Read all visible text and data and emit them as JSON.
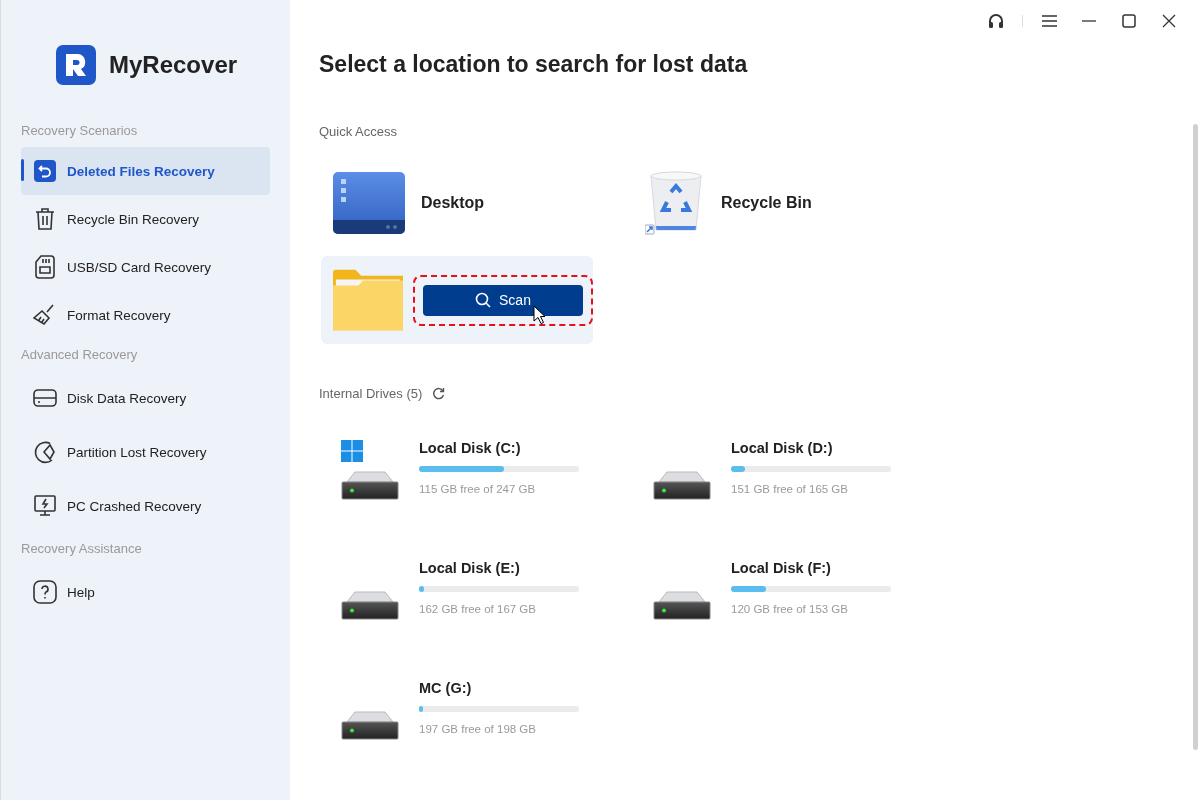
{
  "app": {
    "name": "MyRecover"
  },
  "sidebar": {
    "sections": [
      {
        "heading": "Recovery Scenarios",
        "items": [
          {
            "label": "Deleted Files Recovery",
            "selected": true
          },
          {
            "label": "Recycle Bin Recovery",
            "selected": false
          },
          {
            "label": "USB/SD Card Recovery",
            "selected": false
          },
          {
            "label": "Format Recovery",
            "selected": false
          }
        ]
      },
      {
        "heading": "Advanced Recovery",
        "items": [
          {
            "label": "Disk Data Recovery",
            "selected": false
          },
          {
            "label": "Partition Lost Recovery",
            "selected": false
          },
          {
            "label": "PC Crashed Recovery",
            "selected": false
          }
        ]
      },
      {
        "heading": "Recovery Assistance",
        "items": [
          {
            "label": "Help",
            "selected": false
          }
        ]
      }
    ]
  },
  "title": "Select a location to search for lost data",
  "quick_access": {
    "heading": "Quick Access",
    "items": [
      {
        "label": "Desktop"
      },
      {
        "label": "Recycle Bin"
      }
    ],
    "folder": {
      "button": "Scan",
      "highlighted": true
    }
  },
  "drives": {
    "heading": "Internal Drives (5)",
    "items": [
      {
        "name": "Local Disk (C:)",
        "system": true,
        "level": 0.53,
        "reading": "115 GB free of 247 GB"
      },
      {
        "name": "Local Disk (D:)",
        "system": false,
        "level": 0.085,
        "reading": "151 GB free of 165 GB"
      },
      {
        "name": "Local Disk (E:)",
        "system": false,
        "level": 0.03,
        "reading": "162 GB free of 167 GB"
      },
      {
        "name": "Local Disk (F:)",
        "system": false,
        "level": 0.216,
        "reading": "120 GB free of 153 GB"
      },
      {
        "name": "MC (G:)",
        "system": false,
        "level": 0.005,
        "reading": "197 GB free of 198 GB"
      }
    ]
  }
}
